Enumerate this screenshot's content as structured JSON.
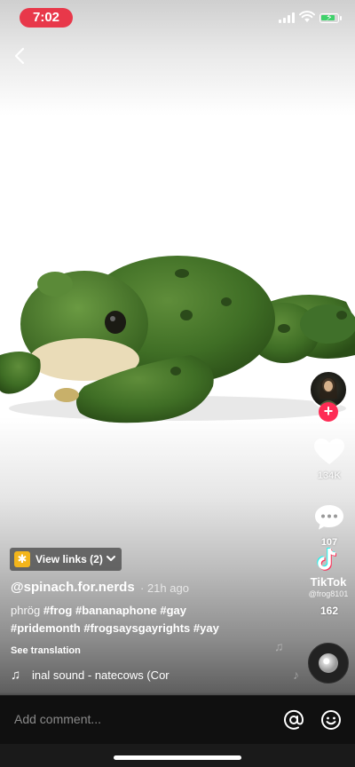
{
  "status_bar": {
    "time": "7:02",
    "battery_level": 0.9,
    "battery_color": "#3fd16b",
    "time_pill_color": "#e8384a"
  },
  "back_icon": "chevron-left-icon",
  "video": {
    "subject": "plush-frog"
  },
  "actions": {
    "like_count": "134K",
    "comment_count": "107",
    "share_count": "162",
    "follow_icon": "plus-icon",
    "accent_color": "#fe2c55"
  },
  "watermark": {
    "brand": "TikTok",
    "handle": "@frog8101"
  },
  "links": {
    "label": "View links (2)"
  },
  "post": {
    "username": "@spinach.for.nerds",
    "time_ago": "· 21h ago",
    "caption_plain": "phrög",
    "caption_tags_1": "#frog #bananaphone #gay",
    "caption_tags_2": "#pridemonth #frogsaysgayrights #yay",
    "see_translation": "See translation",
    "sound": "inal sound - natecows (Cor"
  },
  "comment_bar": {
    "placeholder": "Add comment..."
  }
}
